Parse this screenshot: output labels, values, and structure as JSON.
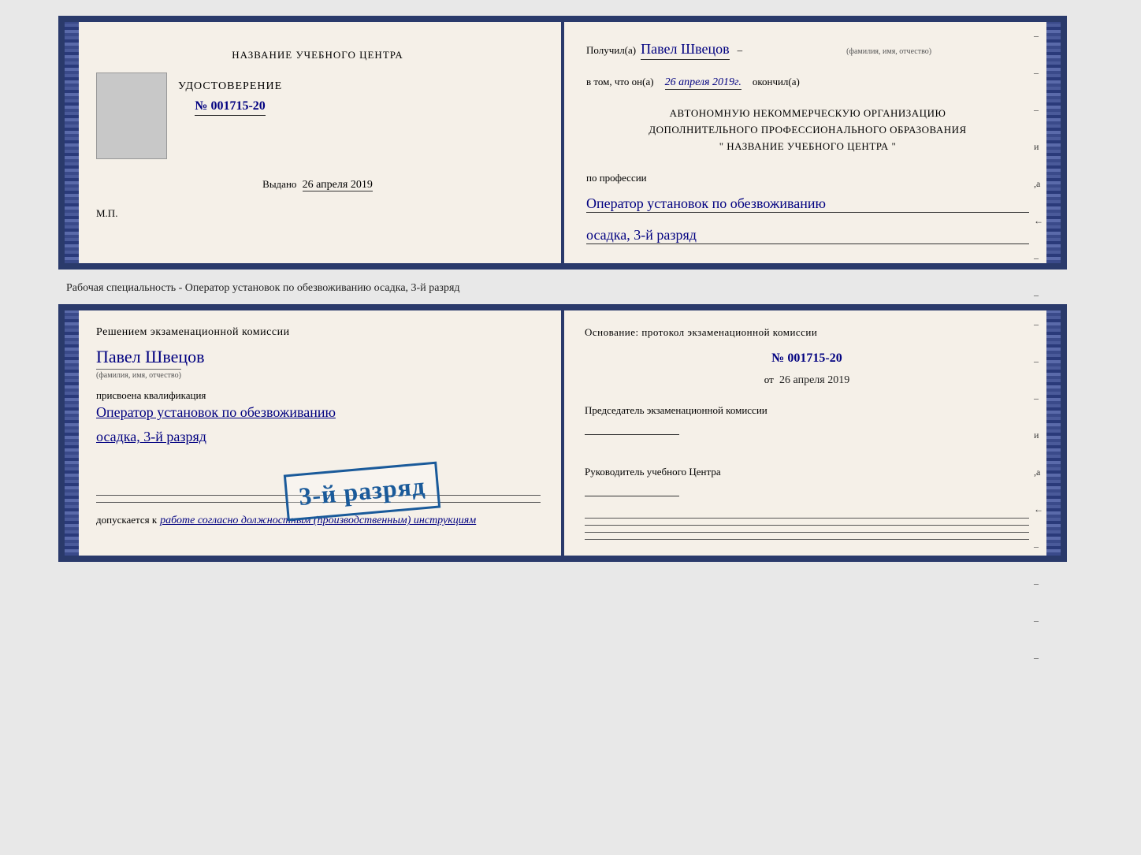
{
  "top": {
    "left": {
      "center_title": "НАЗВАНИЕ УЧЕБНОГО ЦЕНТРА",
      "udost_title": "УДОСТОВЕРЕНИЕ",
      "udost_number": "№ 001715-20",
      "vydano_label": "Выдано",
      "vydano_date": "26 апреля 2019",
      "mp": "М.П."
    },
    "right": {
      "poluchil": "Получил(а)",
      "name": "Павел Швецов",
      "fio_label": "(фамилия, имя, отчество)",
      "dash": "–",
      "vtom": "в том, что он(а)",
      "date": "26 апреля 2019г.",
      "okonchil": "окончил(а)",
      "org_line1": "АВТОНОМНУЮ НЕКОММЕРЧЕСКУЮ ОРГАНИЗАЦИЮ",
      "org_line2": "ДОПОЛНИТЕЛЬНОГО ПРОФЕССИОНАЛЬНОГО ОБРАЗОВАНИЯ",
      "org_line3": "\" НАЗВАНИЕ УЧЕБНОГО ЦЕНТРА \"",
      "po_professii": "по профессии",
      "profession": "Оператор установок по обезвоживанию",
      "razryad": "осадка, 3-й разряд"
    }
  },
  "specialty_note": "Рабочая специальность - Оператор установок по обезвоживанию осадка, 3-й разряд",
  "bottom": {
    "left": {
      "resheniyem": "Решением экзаменационной комиссии",
      "name": "Павел Швецов",
      "fio_label": "(фамилия, имя, отчество)",
      "prisvoyena": "присвоена квалификация",
      "profession": "Оператор установок по обезвоживанию",
      "razryad": "осадка, 3-й разряд",
      "dopuskaetsya": "допускается к",
      "dopusk_text": "работе согласно должностным (производственным) инструкциям"
    },
    "stamp": {
      "text": "3-й разряд"
    },
    "right": {
      "osnovaniye": "Основание: протокол экзаменационной комиссии",
      "number": "№ 001715-20",
      "ot_label": "от",
      "ot_date": "26 апреля 2019",
      "predsedatel_title": "Председатель экзаменационной комиссии",
      "rukovoditel_title": "Руководитель учебного Центра"
    }
  }
}
